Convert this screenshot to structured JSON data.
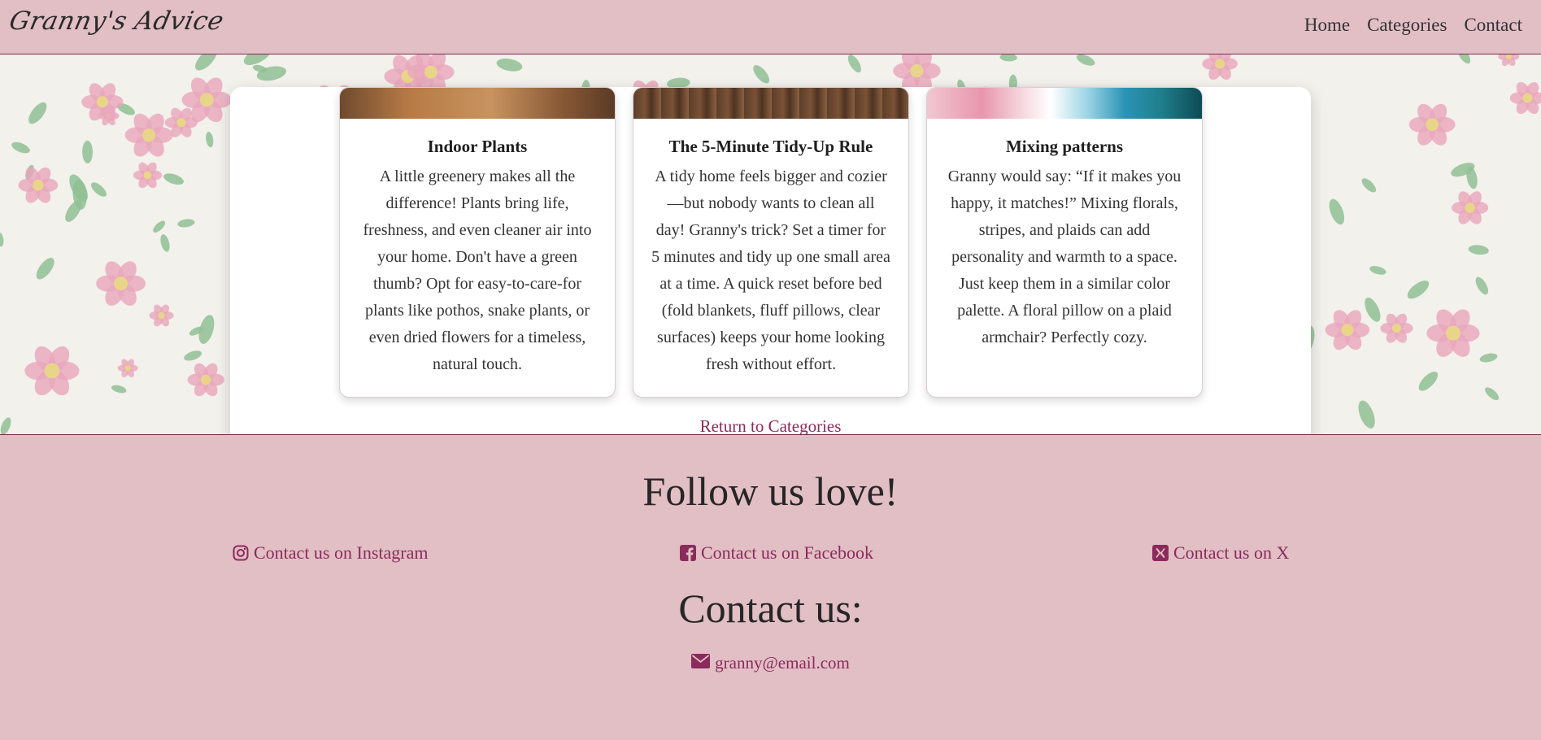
{
  "nav": {
    "brand": "Granny's Advice",
    "links": [
      "Home",
      "Categories",
      "Contact"
    ]
  },
  "cards": [
    {
      "title": "Indoor Plants",
      "text": "A little greenery makes all the difference! Plants bring life, freshness, and even cleaner air into your home. Don't have a green thumb? Opt for easy-to-care-for plants like pothos, snake plants, or even dried flowers for a timeless, natural touch."
    },
    {
      "title": "The 5-Minute Tidy-Up Rule",
      "text": "A tidy home feels bigger and cozier—but nobody wants to clean all day! Granny's trick? Set a timer for 5 minutes and tidy up one small area at a time. A quick reset before bed (fold blankets, fluff pillows, clear surfaces) keeps your home looking fresh without effort."
    },
    {
      "title": "Mixing patterns",
      "text": "Granny would say: “If it makes you happy, it matches!” Mixing florals, stripes, and plaids can add personality and warmth to a space. Just keep them in a similar color palette. A floral pillow on a plaid armchair? Perfectly cozy."
    }
  ],
  "return_link": "Return to Categories",
  "footer": {
    "follow_title": "Follow us love!",
    "instagram": "Contact us on Instagram",
    "facebook": "Contact us on Facebook",
    "x": "Contact us on X",
    "contact_title": "Contact us:",
    "email": "granny@email.com"
  },
  "colors": {
    "pink_bar": "#e2bec5",
    "accent_link": "#8a2b5c",
    "paper": "#f3f1ec",
    "flower_pink": "#e8a6bb",
    "leaf_green": "#8fbf94"
  },
  "icons": [
    "instagram-icon",
    "facebook-icon",
    "x-icon",
    "envelope-icon"
  ]
}
